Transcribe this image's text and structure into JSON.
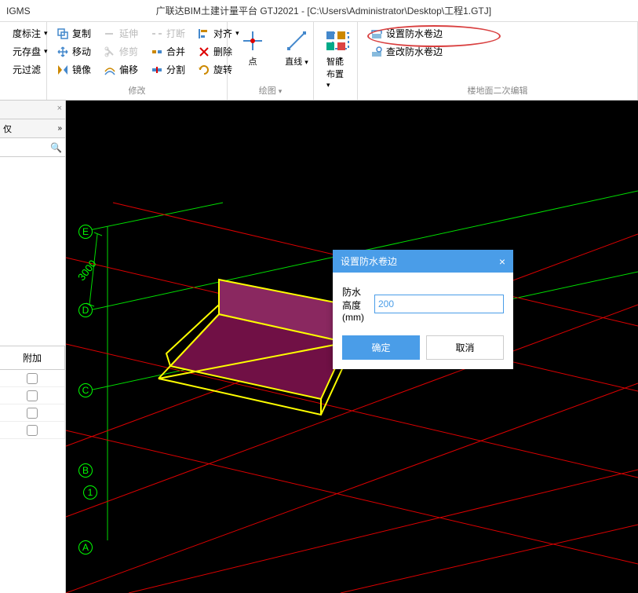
{
  "app": {
    "brand": "IGMS",
    "title": "广联达BIM土建计量平台 GTJ2021 - [C:\\Users\\Administrator\\Desktop\\工程1.GTJ]"
  },
  "ribbon": {
    "group1": {
      "items": [
        "度标注",
        "元存盘",
        "元过滤"
      ]
    },
    "modify": {
      "title": "修改",
      "copy": "复制",
      "move": "移动",
      "mirror": "镜像",
      "extend": "延伸",
      "trim": "修剪",
      "offset": "偏移",
      "break": "打断",
      "merge": "合并",
      "split": "分割",
      "align": "对齐",
      "delete": "删除",
      "rotate": "旋转"
    },
    "draw": {
      "title": "绘图",
      "point": "点",
      "line": "直线"
    },
    "smart": {
      "title": "",
      "smart_layout": "智能布置"
    },
    "secondary": {
      "title": "楼地面二次编辑",
      "set_waterproof": "设置防水卷边",
      "check_waterproof": "查改防水卷边"
    }
  },
  "left_panel": {
    "tab": "仅",
    "search_placeholder": "",
    "table_header": "附加"
  },
  "dialog": {
    "title": "设置防水卷边",
    "label": "防水高度(mm)",
    "value": "200",
    "ok": "确定",
    "cancel": "取消"
  },
  "axis_labels": [
    "E",
    "D",
    "C",
    "B",
    "1",
    "A"
  ],
  "dimension": "3000"
}
